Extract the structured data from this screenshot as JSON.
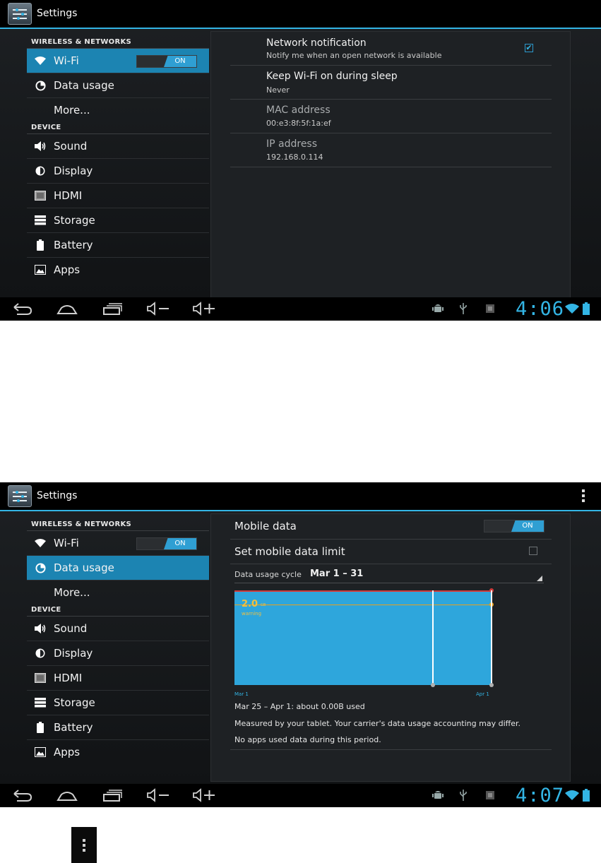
{
  "screen1": {
    "actionbar": {
      "title": "Settings"
    },
    "sidebar": {
      "cat_wireless": "WIRELESS & NETWORKS",
      "wifi": {
        "label": "Wi-Fi",
        "toggle": "ON"
      },
      "data_usage": "Data usage",
      "more": "More...",
      "cat_device": "DEVICE",
      "sound": "Sound",
      "display": "Display",
      "hdmi": "HDMI",
      "storage": "Storage",
      "battery": "Battery",
      "apps": "Apps"
    },
    "prefs": [
      {
        "title": "Network notification",
        "summary": "Notify me when an open network is available"
      },
      {
        "title": "Keep Wi-Fi on during sleep",
        "summary": "Never"
      },
      {
        "title": "MAC address",
        "summary": "00:e3:8f:5f:1a:ef"
      },
      {
        "title": "IP address",
        "summary": "192.168.0.114"
      }
    ],
    "clock": "4:06"
  },
  "screen2": {
    "actionbar": {
      "title": "Settings"
    },
    "sidebar": {
      "cat_wireless": "WIRELESS & NETWORKS",
      "wifi": {
        "label": "Wi-Fi",
        "toggle": "ON"
      },
      "data_usage": "Data usage",
      "more": "More...",
      "cat_device": "DEVICE",
      "sound": "Sound",
      "display": "Display",
      "hdmi": "HDMI",
      "storage": "Storage",
      "battery": "Battery",
      "apps": "Apps"
    },
    "mobile_data": {
      "label": "Mobile data",
      "toggle": "ON"
    },
    "limit": {
      "label": "Set mobile data limit"
    },
    "cycle": {
      "label": "Data usage cycle",
      "value": "Mar 1 – 31"
    },
    "graph": {
      "warning_value": "2.0",
      "warning_unit": "GB",
      "warning_label": "warning",
      "x_start": "Mar 1",
      "x_end": "Apr 1"
    },
    "usage_summary": "Mar 25 – Apr 1: about 0.00B used",
    "note1": "Measured by your tablet. Your carrier's data usage accounting may differ.",
    "note2": "No apps used data during this period.",
    "clock": "4:07"
  },
  "colors": {
    "accent": "#33b5e5",
    "selected": "#1c84b2",
    "graph": "#2ea6dc",
    "limit": "#d13b3b",
    "warning": "#e8a11d"
  }
}
